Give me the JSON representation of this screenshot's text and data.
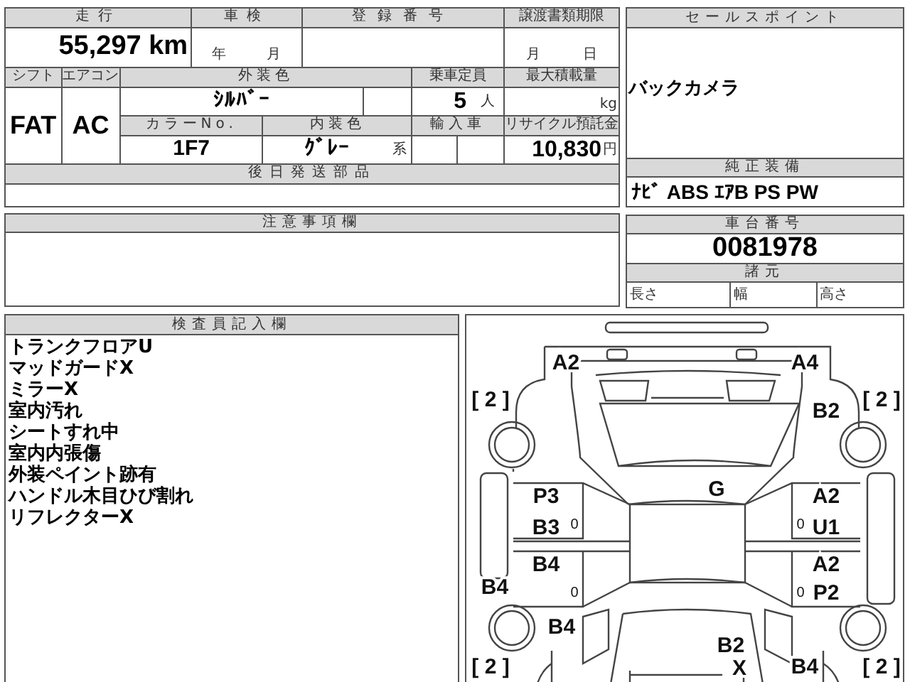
{
  "info_table": {
    "mileage": {
      "label": "走行",
      "value": "55,297",
      "unit": "km"
    },
    "inspection": {
      "label": "車検",
      "year_unit": "年",
      "month_unit": "月"
    },
    "registration": {
      "label": "登録番号"
    },
    "transfer_deadline": {
      "label": "譲渡書類期限",
      "month_unit": "月",
      "day_unit": "日"
    },
    "shift": {
      "label": "シフト",
      "value": "FAT"
    },
    "aircon": {
      "label": "エアコン",
      "value": "AC"
    },
    "exterior_color": {
      "label": "外装色",
      "value": "ｼﾙﾊﾞｰ"
    },
    "capacity": {
      "label": "乗車定員",
      "value": "5",
      "unit": "人"
    },
    "max_load": {
      "label": "最大積載量",
      "unit": "kg"
    },
    "color_no": {
      "label": "カラーNo.",
      "value": "1F7"
    },
    "interior_color": {
      "label": "内装色",
      "value": "ｸﾞﾚｰ",
      "suffix": "系"
    },
    "import": {
      "label": "輸入車"
    },
    "recycle": {
      "label": "リサイクル預託金",
      "value": "10,830",
      "unit": "円"
    },
    "later_parts": {
      "label": "後日発送部品"
    }
  },
  "sales_point": {
    "label": "セールスポイント",
    "text": "バックカメラ"
  },
  "equipment": {
    "label": "純正装備",
    "text": "ﾅﾋﾞ ABS ｴｱB PS PW"
  },
  "chassis": {
    "label": "車台番号",
    "value": "0081978"
  },
  "specs": {
    "label": "諸元",
    "items": [
      "長さ",
      "幅",
      "高さ"
    ]
  },
  "notes": {
    "label": "注意事項欄"
  },
  "inspector": {
    "label": "検査員記入欄",
    "lines": [
      "トランクフロアU",
      "マッドガードX",
      "ミラーX",
      "室内汚れ",
      "シートすれ中",
      "室内内張傷",
      "外装ペイント跡有",
      "ハンドル木目ひび割れ",
      "リフレクターX"
    ]
  },
  "diagram": {
    "marks": [
      {
        "text": "A2"
      },
      {
        "text": "A4"
      },
      {
        "text": "[ 2 ]"
      },
      {
        "text": "[ 2 ]"
      },
      {
        "text": "B2"
      },
      {
        "text": "G"
      },
      {
        "text": "P3"
      },
      {
        "text": "B3"
      },
      {
        "text": "0"
      },
      {
        "text": "A2"
      },
      {
        "text": "0"
      },
      {
        "text": "U1"
      },
      {
        "text": "B4"
      },
      {
        "text": "A2"
      },
      {
        "text": "B4"
      },
      {
        "text": "0"
      },
      {
        "text": "0"
      },
      {
        "text": "P2"
      },
      {
        "text": "B4"
      },
      {
        "text": "B2"
      },
      {
        "text": "[ 2 ]"
      },
      {
        "text": "X"
      },
      {
        "text": "B4"
      },
      {
        "text": "[ 2 ]"
      }
    ]
  }
}
